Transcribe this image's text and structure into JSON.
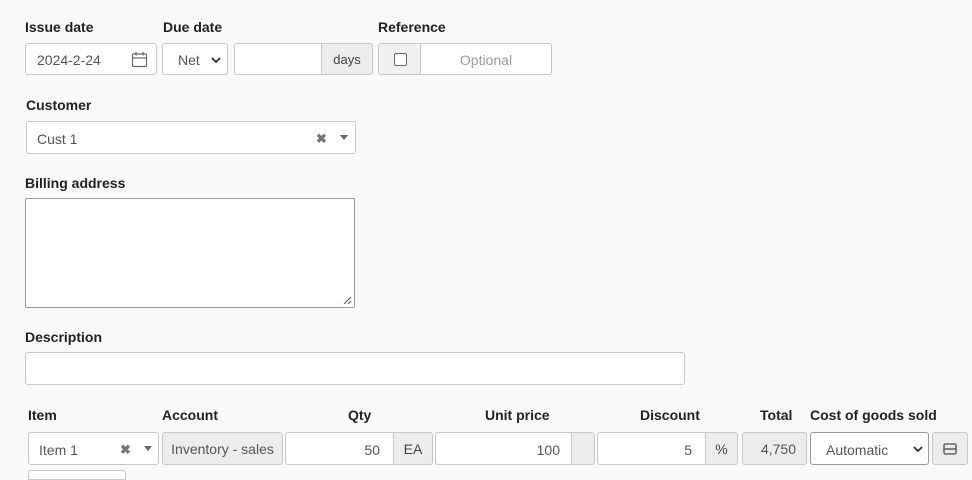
{
  "form": {
    "issue_date": {
      "label": "Issue date",
      "value": "2024-2-24"
    },
    "due_date": {
      "label": "Due date",
      "mode": "Net",
      "days_value": "",
      "days_unit": "days"
    },
    "reference": {
      "label": "Reference",
      "placeholder": "Optional"
    },
    "customer": {
      "label": "Customer",
      "value": "Cust 1"
    },
    "billing_address": {
      "label": "Billing address",
      "value": ""
    },
    "description": {
      "label": "Description",
      "value": ""
    }
  },
  "lines": {
    "headers": {
      "item": "Item",
      "account": "Account",
      "qty": "Qty",
      "unit_price": "Unit price",
      "discount": "Discount",
      "total": "Total",
      "cogs": "Cost of goods sold"
    },
    "rows": [
      {
        "item": "Item 1",
        "account": "Inventory - sales",
        "qty": "50",
        "unit": "EA",
        "unit_price": "100",
        "discount": "5",
        "discount_unit": "%",
        "total": "4,750",
        "cogs": "Automatic"
      }
    ]
  },
  "icons": {
    "calendar": "calendar-icon",
    "clear": "clear-x-icon",
    "dropdown": "chevron-down-icon",
    "resize": "resize-handle-icon",
    "row_menu": "row-options-icon"
  }
}
